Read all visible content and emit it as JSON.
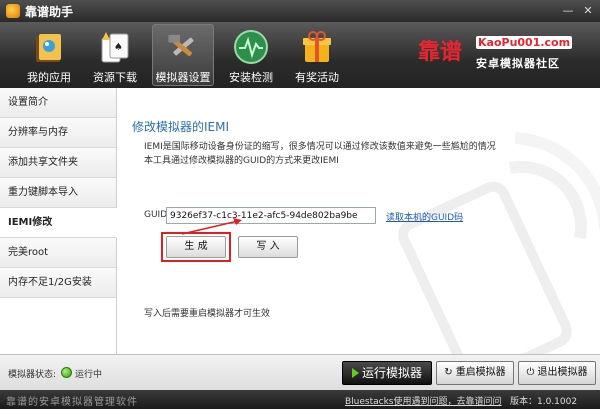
{
  "window": {
    "title": "靠谱助手",
    "minimize": "—",
    "close": "✕"
  },
  "toolbar": {
    "items": [
      {
        "label": "我的应用",
        "icon": "book-icon"
      },
      {
        "label": "资源下载",
        "icon": "cards-icon"
      },
      {
        "label": "模拟器设置",
        "icon": "tools-icon",
        "active": true
      },
      {
        "label": "安装检测",
        "icon": "monitor-icon"
      },
      {
        "label": "有奖活动",
        "icon": "gift-icon"
      }
    ]
  },
  "brand": {
    "name": "靠谱",
    "url": "KaoPu001.com",
    "subtitle": "安卓模拟器社区"
  },
  "sidebar": {
    "items": [
      {
        "label": "设置简介"
      },
      {
        "label": "分辨率与内存"
      },
      {
        "label": "添加共享文件夹"
      },
      {
        "label": "重力键脚本导入"
      },
      {
        "label": "IEMI修改",
        "active": true
      },
      {
        "label": "完美root"
      },
      {
        "label": "内存不足1/2G安装"
      }
    ]
  },
  "main": {
    "title": "修改模拟器的IEMI",
    "desc_line1": "IEMI是国际移动设备身份证的缩写，很多情况可以通过修改该数值来避免一些尴尬的情况",
    "desc_line2": "本工具通过修改模拟器的GUID的方式来更改IEMI",
    "guid_label": "GUID:",
    "guid_value": "9326ef37-c1c3-11e2-afc5-94de802ba9be",
    "guid_link": "读取本机的GUID码",
    "generate_button": "生 成",
    "write_button": "写 入",
    "note": "写入后需要重启模拟器才可生效"
  },
  "bottom": {
    "status_label": "模拟器状态:",
    "status_value": "运行中",
    "run_button": "运行模拟器",
    "restart_button": "重启模拟器",
    "exit_button": "退出模拟器"
  },
  "footer": {
    "left_text": "靠谱的安卓模拟器管理软件",
    "link": "Bluestacks使用遇到问题，去靠谱问问",
    "version": "版本：1.0.1002"
  },
  "colors": {
    "accent": "#2b6fb3",
    "brand_red": "#e8242e",
    "highlight_red": "#e02020"
  }
}
